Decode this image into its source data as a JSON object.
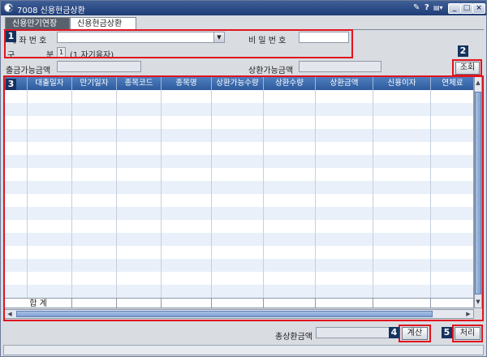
{
  "window": {
    "title": "7008 신용현금상환",
    "help_icon": "?",
    "menu_icon": "▤▾"
  },
  "tabs": [
    {
      "label": "신용만기연장"
    },
    {
      "label": "신용현금상환"
    }
  ],
  "form": {
    "account_label": "계 좌 번 호",
    "account_value": "",
    "password_label": "비 밀 번 호",
    "password_value": "",
    "type_label_left": "구",
    "type_label_right": "분",
    "type_value": "1",
    "type_hint": "(1.자기융자)",
    "withdrawable_label": "출금가능금액",
    "withdrawable_value": "",
    "repayable_label": "상환가능금액",
    "repayable_value": "",
    "search_button": "조회"
  },
  "table": {
    "columns": [
      "대출일자",
      "만기일자",
      "종목코드",
      "종목명",
      "상환가능수량",
      "상환수량",
      "상환금액",
      "신용이자",
      "연체료"
    ],
    "row_count": 16,
    "footer_label": "합 계"
  },
  "bottom": {
    "total_label": "총상환금액",
    "total_value": "",
    "calc_button": "계산",
    "process_button": "처리"
  },
  "badges": [
    "1",
    "2",
    "3",
    "4",
    "5"
  ],
  "colors": {
    "marker": "#e0141e",
    "badge_bg": "#15325f",
    "header_bg": "#2d5a9c",
    "title_bg": "#1f3c76"
  }
}
